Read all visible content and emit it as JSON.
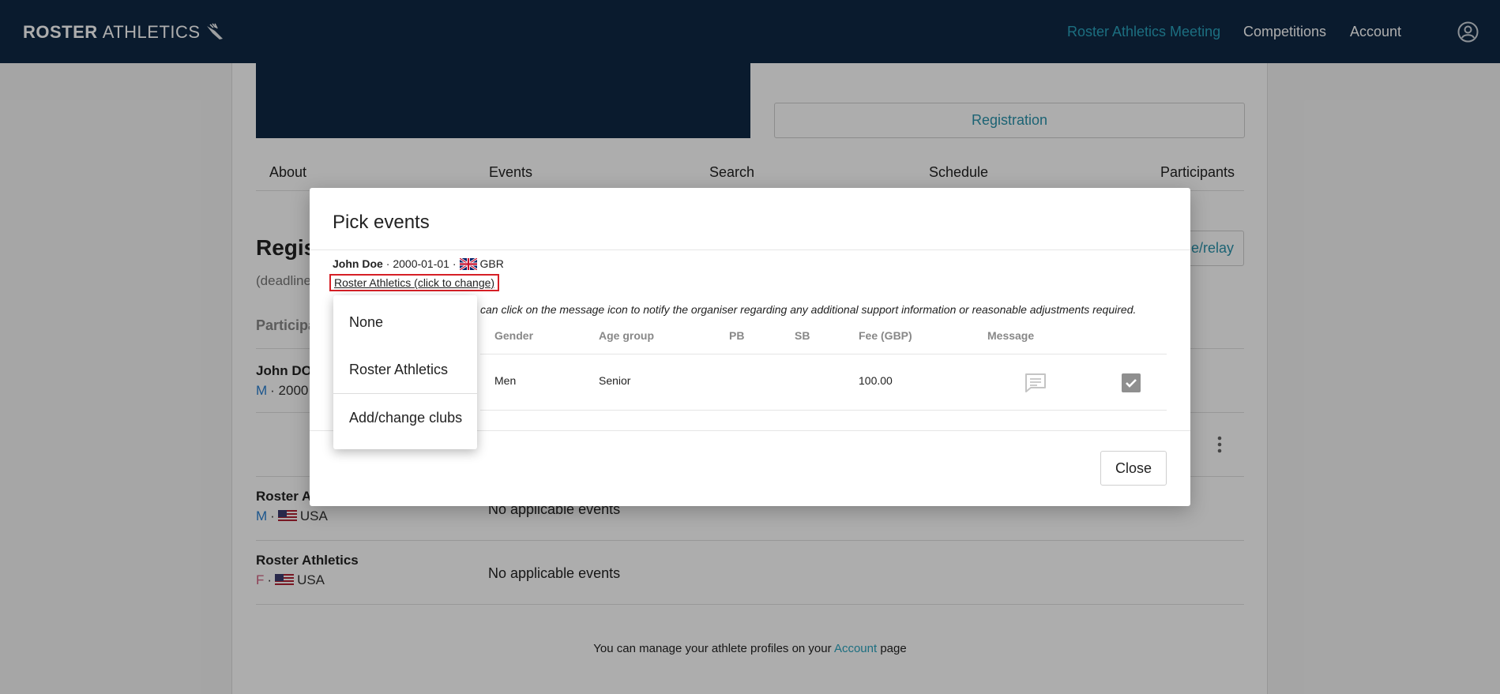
{
  "header": {
    "brand_bold": "ROSTER",
    "brand_thin": "ATHLETICS",
    "nav": [
      "Roster Athletics Meeting",
      "Competitions",
      "Account"
    ]
  },
  "page": {
    "registration_label": "Registration",
    "tabs": [
      "About",
      "Events",
      "Search",
      "Schedule",
      "Participants"
    ],
    "reg_title": "Regis",
    "deadline": "(deadline",
    "relay_button": "e/relay",
    "participants_header": "Participa",
    "athletes": [
      {
        "name": "John DO",
        "gender": "M",
        "meta": "· 2000"
      },
      {
        "name": "Roster A",
        "gender": "M",
        "meta": "USA",
        "events": "No applicable events"
      },
      {
        "name": "Roster Athletics",
        "gender": "F",
        "meta": "USA",
        "events": "No applicable events"
      }
    ],
    "footer_prefix": "You can manage your athlete profiles on your",
    "footer_link": "Account",
    "footer_suffix": "page"
  },
  "modal": {
    "title": "Pick events",
    "athlete_name": "John Doe",
    "athlete_dob": "· 2000-01-01 ·",
    "athlete_country": "GBR",
    "club_link": "Roster Athletics (click to change)",
    "info": "can click on the message icon to notify the organiser regarding any additional support information or reasonable adjustments required.",
    "columns": [
      "Gender",
      "Age group",
      "PB",
      "SB",
      "Fee (GBP)",
      "Message"
    ],
    "row": {
      "gender": "Men",
      "age_group": "Senior",
      "pb": "",
      "sb": "",
      "fee": "100.00"
    },
    "close_label": "Close"
  },
  "dropdown": {
    "items": [
      "None",
      "Roster Athletics",
      "Add/change clubs"
    ]
  },
  "colors": {
    "navy": "#0f2844",
    "accent": "#2aa3bd",
    "highlight_border": "#d61f26"
  }
}
